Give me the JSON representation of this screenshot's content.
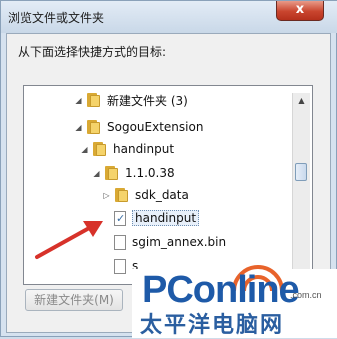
{
  "dialog": {
    "title": "浏览文件或文件夹",
    "close_label": "x",
    "prompt": "从下面选择快捷方式的目标:",
    "new_folder_label": "新建文件夹(M)"
  },
  "tree": {
    "rows": [
      {
        "label": "新建文件夹 (3)",
        "type": "folder",
        "expander": "▲"
      },
      {
        "label": "SogouExtension",
        "type": "folder",
        "expander": "◢"
      },
      {
        "label": "handinput",
        "type": "folder",
        "expander": "◢"
      },
      {
        "label": "1.1.0.38",
        "type": "folder",
        "expander": "◢"
      },
      {
        "label": "sdk_data",
        "type": "folder",
        "expander": "▷"
      },
      {
        "label": "handinput",
        "type": "file-checked",
        "expander": ""
      },
      {
        "label": "sgim_annex.bin",
        "type": "file",
        "expander": ""
      },
      {
        "label": "s",
        "type": "file",
        "expander": ""
      }
    ],
    "selected_index": 5
  },
  "scrollbar": {
    "up": "▲",
    "down": "▼"
  },
  "watermark": {
    "brand": "PConline",
    "domain": ".com.cn",
    "chinese": "太平洋电脑网"
  },
  "colors": {
    "accent": "#2a5ea0",
    "arrow": "#d7322a",
    "close": "#c9452e"
  }
}
